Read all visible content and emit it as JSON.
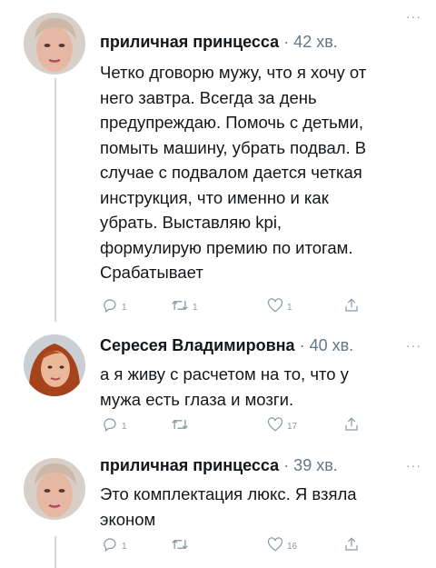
{
  "tweets": [
    {
      "author": "приличная принцесса",
      "time": "· 42 хв.",
      "text": "Четко дговорю мужу, что я хочу от\nнего завтра. Всегда за день\nпредупреждаю. Помочь с детьми,\nпомыть машину, убрать подвал. В\nслучае с подвалом дается четкая\nинструкция, что именно и как\nубрать.  Выставляю kpi,\nформулирую премию по итогам.\nСрабатывает",
      "replies": "1",
      "retweets": "1",
      "likes": "1",
      "more": "···"
    },
    {
      "author": "Сересея Владимировна",
      "time": "· 40 хв.",
      "text": "а я живу с расчетом на то, что у\nмужа есть глаза и мозги.",
      "replies": "1",
      "retweets": "",
      "likes": "17",
      "more": "···"
    },
    {
      "author": "приличная принцесса",
      "time": "· 39 хв.",
      "text": "Это комплектация люкс. Я взяла\nэконом",
      "replies": "1",
      "retweets": "",
      "likes": "16",
      "more": "···"
    }
  ],
  "colors": {
    "text": "#14171a",
    "meta": "#657786",
    "icon": "#8899a6",
    "line": "#cfd9de"
  }
}
